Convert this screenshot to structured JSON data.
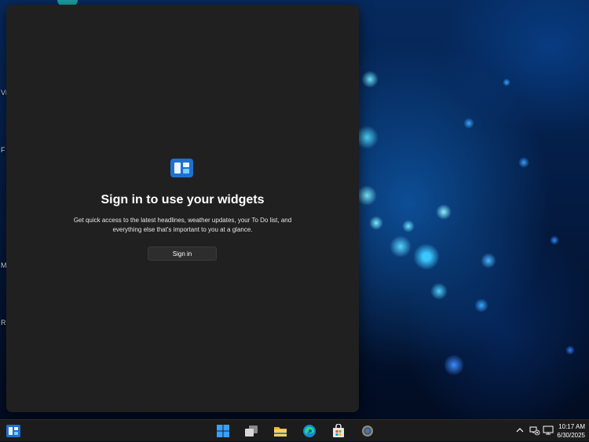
{
  "desktop": {
    "labels": [
      "Vi",
      "F",
      "M",
      "R"
    ]
  },
  "widgets_panel": {
    "icon": "widgets-icon",
    "title": "Sign in to use your widgets",
    "description_line1": "Get quick access to the latest headlines, weather updates, your To Do list, and",
    "description_line2": "everything else that's important to you at a glance.",
    "signin_label": "Sign in"
  },
  "taskbar": {
    "left_icon": "widgets-icon",
    "pinned": [
      "start-icon",
      "task-view-icon",
      "file-explorer-icon",
      "edge-icon",
      "store-icon",
      "settings-icon"
    ],
    "tray": {
      "chevron": "chevron-up-icon",
      "network": "network-offline-icon",
      "display": "display-icon",
      "time": "10:17 AM",
      "date": "6/30/2025"
    }
  },
  "colors": {
    "panel_bg": "#202020",
    "taskbar_bg": "#1c1c1c",
    "accent": "#1f6fd1"
  }
}
